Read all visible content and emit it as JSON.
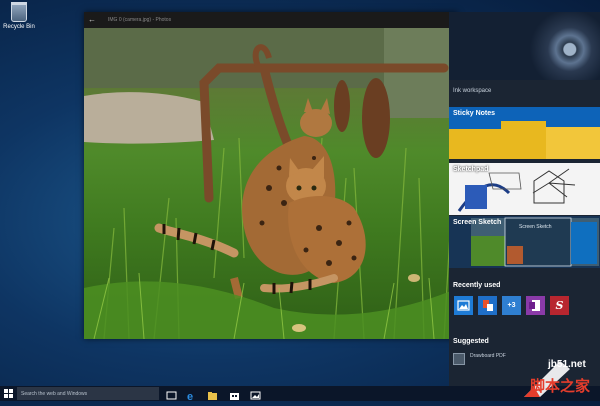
{
  "desktop": {
    "recycle_bin_label": "Recycle Bin"
  },
  "photo_window": {
    "title": "IMG 0 (camera.jpg) - Photos",
    "photo_subject": "two bengal cats in grass"
  },
  "ink_workspace": {
    "title": "Ink workspace",
    "tiles": [
      {
        "label": "Sticky Notes"
      },
      {
        "label": "Sketchpad"
      },
      {
        "label": "Screen Sketch"
      }
    ],
    "screen_sketch_thumb_label": "Screen Sketch",
    "recently_used_title": "Recently used",
    "recent_apps": [
      {
        "icon": "photos-icon",
        "color": "#1e7bd6"
      },
      {
        "icon": "office-icon",
        "color": "#1f6fc9"
      },
      {
        "icon": "calculator-icon",
        "color": "#2f7fd1",
        "text": "+3"
      },
      {
        "icon": "onenote-icon",
        "color": "#8a3aa8"
      },
      {
        "icon": "sketchable-icon",
        "color": "#b8262f"
      }
    ],
    "suggested_title": "Suggested",
    "suggested_item": "Drawboard PDF"
  },
  "taskbar": {
    "search_placeholder": "Search the web and Windows"
  },
  "watermark": {
    "url": "jb51.net",
    "cn": "脚本之家"
  }
}
